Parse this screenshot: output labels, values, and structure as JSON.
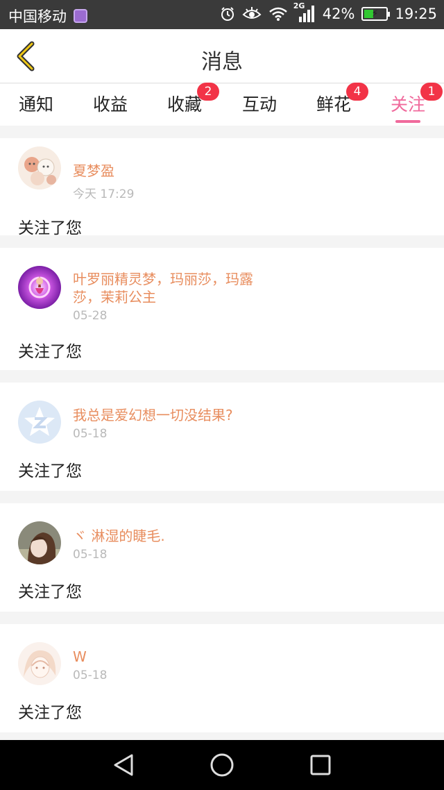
{
  "status_bar": {
    "carrier": "中国移动",
    "network": "2G",
    "battery": "42%",
    "battery_level": 0.42,
    "time": "19:25",
    "icons": [
      "app-notification-icon",
      "alarm-icon",
      "eye-icon",
      "wifi-icon",
      "signal-icon",
      "battery-charging-icon"
    ]
  },
  "header": {
    "title": "消息",
    "back_icon": "chevron-left-icon"
  },
  "tabs": [
    {
      "label": "通知",
      "badge": ""
    },
    {
      "label": "收益",
      "badge": ""
    },
    {
      "label": "收藏",
      "badge": "2"
    },
    {
      "label": "互动",
      "badge": ""
    },
    {
      "label": "鲜花",
      "badge": "4"
    },
    {
      "label": "关注",
      "badge": "1",
      "active": true
    }
  ],
  "colors": {
    "accent": "#f06a9c",
    "username": "#e88d5e",
    "badge": "#f23347",
    "timestamp": "#b9b9b9"
  },
  "messages": [
    {
      "name": "夏梦盈",
      "time": "今天 17:29",
      "text": "关注了您",
      "avatar": "anime-girls-avatar"
    },
    {
      "name": "叶罗丽精灵梦，玛丽莎，玛露莎，茉莉公主",
      "time": "05-28",
      "text": "关注了您",
      "avatar": "purple-fairy-avatar"
    },
    {
      "name": "我总是爱幻想一切没结果?",
      "time": "05-18",
      "text": "关注了您",
      "avatar": "default-qq-avatar"
    },
    {
      "name": "ヾ 淋湿的睫毛.",
      "time": "05-18",
      "text": "关注了您",
      "avatar": "girl-photo-avatar"
    },
    {
      "name": "W",
      "time": "05-18",
      "text": "关注了您",
      "avatar": "anime-sketch-avatar"
    }
  ],
  "nav_bar": {
    "icons": [
      "back-triangle-icon",
      "home-circle-icon",
      "recents-square-icon"
    ]
  }
}
